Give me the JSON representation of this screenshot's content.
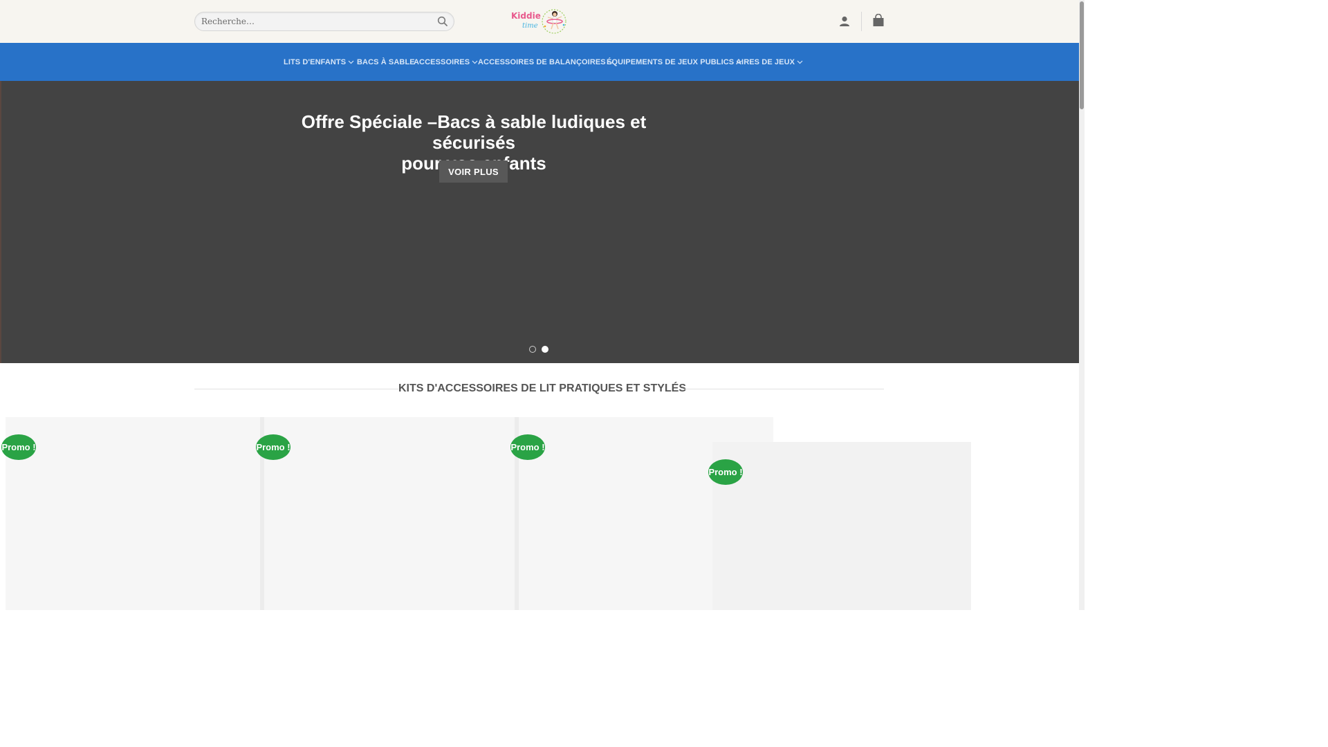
{
  "header": {
    "search_placeholder": "Recherche…",
    "logo": {
      "word1": "Kiddie",
      "word2": "time"
    }
  },
  "nav": {
    "items": [
      {
        "label": "LITS D'ENFANTS",
        "has_dropdown": true
      },
      {
        "label": "BACS À SABLE",
        "has_dropdown": false
      },
      {
        "label": "ACCESSOIRES",
        "has_dropdown": true
      },
      {
        "label": "ACCESSOIRES DE BALANÇOIRES",
        "has_dropdown": true
      },
      {
        "label": "ÉQUIPEMENTS DE JEUX PUBLICS",
        "has_dropdown": true
      },
      {
        "label": "AIRES DE JEUX",
        "has_dropdown": true
      }
    ]
  },
  "hero": {
    "title_line1": "Offre Spéciale –Bacs à sable ludiques et sécurisés",
    "title_line2": "pour vos enfants",
    "button_label": "VOIR PLUS",
    "slide_count": 2,
    "active_slide": 2
  },
  "section": {
    "title": "KITS D'ACCESSOIRES DE LIT PRATIQUES ET STYLÉS"
  },
  "products": [
    {
      "badge": "Promo !"
    },
    {
      "badge": "Promo !"
    },
    {
      "badge": "Promo !"
    },
    {
      "badge": "Promo !"
    }
  ],
  "colors": {
    "topbar_bg": "#f7f5f0",
    "nav_bg": "#2872c8",
    "hero_bg": "#434343",
    "promo_badge": "#2aa345",
    "logo_pink": "#e85a8d",
    "logo_blue": "#45b3e0"
  },
  "icons": {
    "search": "search-icon",
    "account": "user-icon",
    "cart": "cart-icon",
    "dropdown": "chevron-down-icon"
  }
}
